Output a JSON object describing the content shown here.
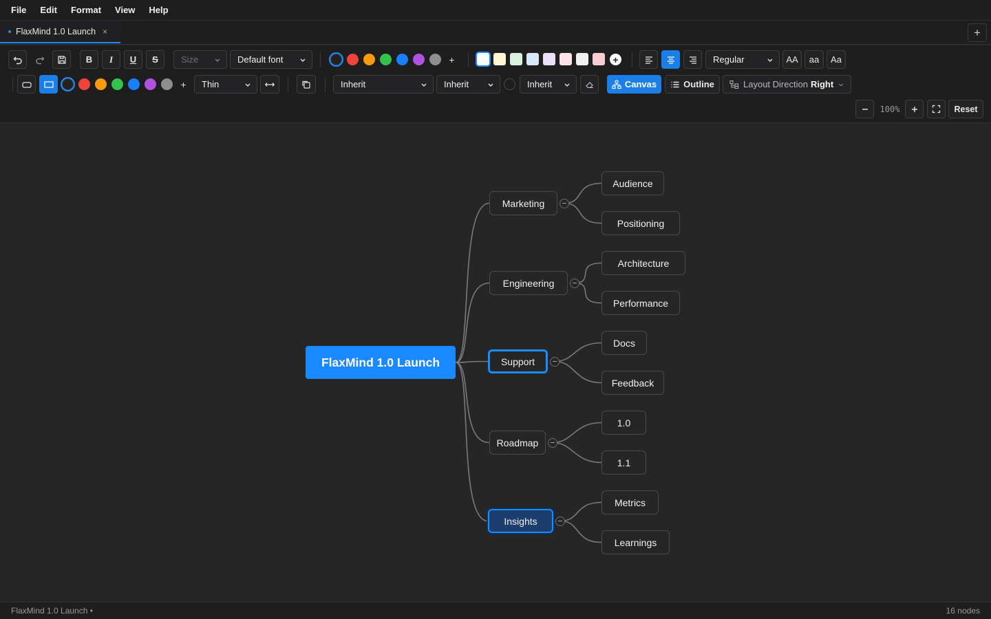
{
  "menu": [
    "File",
    "Edit",
    "Format",
    "View",
    "Help"
  ],
  "tab": {
    "title": "FlaxMind 1.0 Launch",
    "close": "×",
    "add": "+"
  },
  "toolbar": {
    "bold": "B",
    "italic": "I",
    "underline": "U",
    "strike": "S",
    "size_placeholder": "Size",
    "font": "Default font",
    "text_colors": [
      "#222222",
      "#f0443a",
      "#f79a0f",
      "#33c34c",
      "#1a7fff",
      "#b152e0",
      "#8e8e90"
    ],
    "fill_colors": [
      "#ffffff",
      "#fff6d6",
      "#d8f2e0",
      "#d6e8ff",
      "#e7e0f7",
      "#fde2e6",
      "#efeff1",
      "#f8ccd2"
    ],
    "weight": "Regular",
    "case_upper": "AA",
    "case_lower": "aa",
    "case_title": "Aa",
    "border_colors": [
      "#222222",
      "#f0443a",
      "#f79a0f",
      "#33c34c",
      "#1a7fff",
      "#b152e0",
      "#8e8e90"
    ],
    "border_width": "Thin",
    "line_style": "Inherit",
    "line_width": "Inherit",
    "line_end": "Inherit",
    "canvas_label": "Canvas",
    "outline_label": "Outline",
    "layout_direction_label": "Layout Direction",
    "layout_direction_value": "Right",
    "zoom": "100%",
    "reset": "Reset"
  },
  "mindmap": {
    "root": "FlaxMind 1.0 Launch",
    "branches": [
      {
        "label": "Marketing",
        "children": [
          "Audience",
          "Positioning"
        ]
      },
      {
        "label": "Engineering",
        "children": [
          "Architecture",
          "Performance"
        ]
      },
      {
        "label": "Support",
        "children": [
          "Docs",
          "Feedback"
        ]
      },
      {
        "label": "Roadmap",
        "children": [
          "1.0",
          "1.1"
        ]
      },
      {
        "label": "Insights",
        "children": [
          "Metrics",
          "Learnings"
        ]
      }
    ]
  },
  "status": {
    "doc": "FlaxMind 1.0 Launch •",
    "count": "16 nodes"
  }
}
